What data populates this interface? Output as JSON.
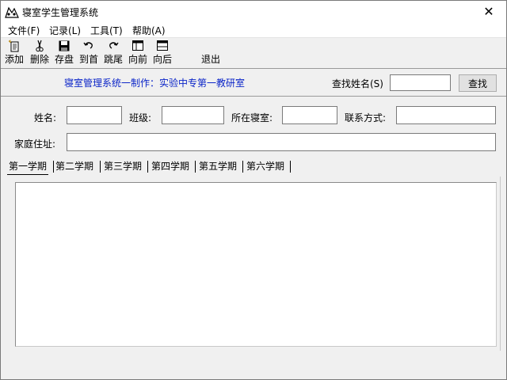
{
  "window": {
    "title": "寝室学生管理系统",
    "close_symbol": "✕"
  },
  "menu": [
    "文件(F)",
    "记录(L)",
    "工具(T)",
    "帮助(A)"
  ],
  "toolbar": [
    {
      "label": "添加",
      "icon": "add-record-icon"
    },
    {
      "label": "删除",
      "icon": "scissors-icon"
    },
    {
      "label": "存盘",
      "icon": "save-icon"
    },
    {
      "label": "到首",
      "icon": "undo-arrow-icon"
    },
    {
      "label": "跳尾",
      "icon": "redo-arrow-icon"
    },
    {
      "label": "向前",
      "icon": "window-back-icon"
    },
    {
      "label": "向后",
      "icon": "window-forward-icon"
    },
    {
      "label": "退出",
      "icon": ""
    }
  ],
  "info": {
    "credit": "寝室管理系统一制作：实验中专第一教研室",
    "search_label": "查找姓名(S)",
    "search_value": "",
    "search_button": "查找"
  },
  "form": {
    "name_label": "姓名:",
    "class_label": "班级:",
    "room_label": "所在寝室:",
    "contact_label": "联系方式:",
    "address_label": "家庭住址:",
    "name_value": "",
    "class_value": "",
    "room_value": "",
    "contact_value": "",
    "address_value": ""
  },
  "tabs": [
    "第一学期",
    "第二学期",
    "第三学期",
    "第四学期",
    "第五学期",
    "第六学期"
  ],
  "active_tab": "第一学期",
  "colors": {
    "credit_text": "#0a24c8",
    "window_bg": "#f0f0f0"
  }
}
